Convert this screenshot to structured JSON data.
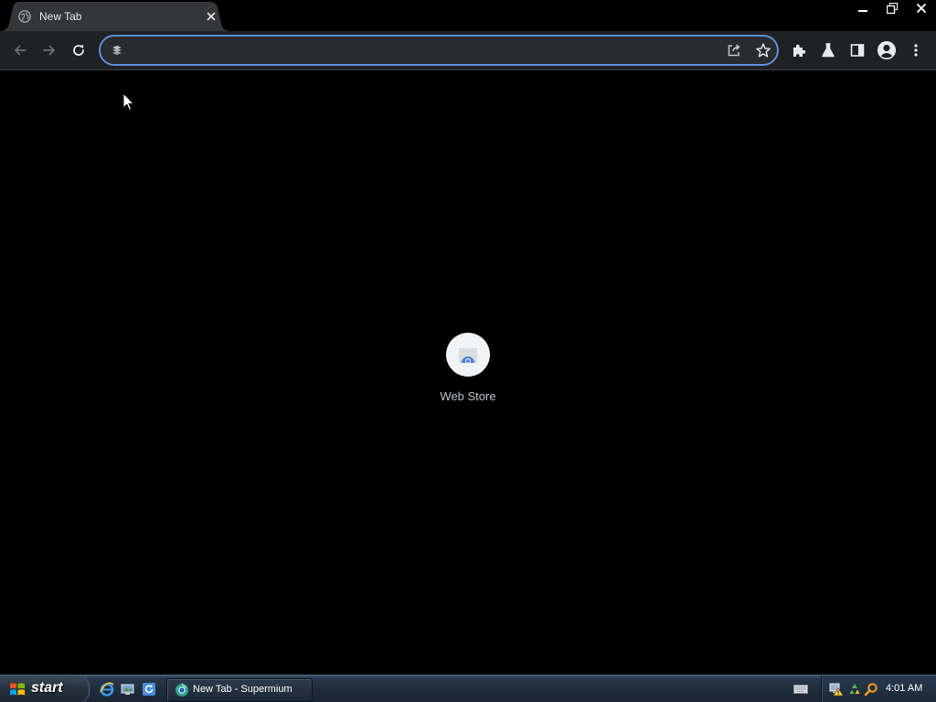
{
  "browser": {
    "tab": {
      "title": "New Tab",
      "favicon": "globe-icon",
      "close_icon": "close-icon"
    },
    "window_controls": [
      "minimize-icon",
      "restore-icon",
      "close-icon"
    ],
    "toolbar": {
      "nav_icons": [
        "back-arrow-icon",
        "forward-arrow-icon",
        "reload-icon"
      ],
      "omnibox": {
        "value": "",
        "placeholder": "",
        "left_icon": "page-info-icon",
        "right_icons": [
          "share-icon",
          "bookmark-star-icon"
        ]
      },
      "extension_icons": [
        "extensions-puzzle-icon",
        "labs-flask-icon",
        "side-panel-icon",
        "profile-avatar-icon",
        "menu-kebab-icon"
      ]
    },
    "new_tab_page": {
      "shortcuts": [
        {
          "label": "Web Store",
          "icon": "web-store-icon"
        }
      ]
    }
  },
  "taskbar": {
    "start_label": "start",
    "quick_launch": [
      "internet-explorer-icon",
      "show-desktop-icon",
      "refresh-app-icon"
    ],
    "task_button": {
      "label": "New Tab - Supermium",
      "icon": "supermium-icon"
    },
    "tray_icons": [
      "keyboard-icon",
      "network-warning-icon",
      "recycle-icon",
      "search-icon"
    ],
    "clock": "4:01 AM"
  },
  "colors": {
    "page_background": "#000000",
    "toolbar_background": "#202124",
    "omnibox_focus_ring": "#5e8fd8",
    "tab_background": "#35363a",
    "tile_background": "#f1f3f4",
    "tile_label": "#bdc1c6"
  }
}
